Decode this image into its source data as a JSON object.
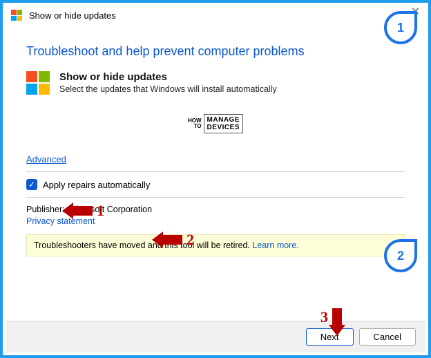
{
  "window": {
    "title": "Show or hide updates"
  },
  "heading": "Troubleshoot and help prevent computer problems",
  "section": {
    "title": "Show or hide updates",
    "subtitle": "Select the updates that Windows will install automatically"
  },
  "watermark": {
    "side_top": "HOW",
    "side_bottom": "TO",
    "main_top": "MANAGE",
    "main_bottom": "DEVICES"
  },
  "advanced_label": "Advanced",
  "checkbox": {
    "checked": true,
    "label": "Apply repairs automatically"
  },
  "publisher_label": "Publisher:",
  "publisher_value": "Microsoft Corporation",
  "privacy_label": "Privacy statement",
  "notice": {
    "text": "Troubleshooters have moved and this tool will be retired. ",
    "learn_more": "Learn more."
  },
  "buttons": {
    "next": "Next",
    "cancel": "Cancel"
  },
  "annotations": {
    "a1": "1",
    "a2": "2",
    "a3": "3",
    "td1": "1",
    "td2": "2"
  }
}
